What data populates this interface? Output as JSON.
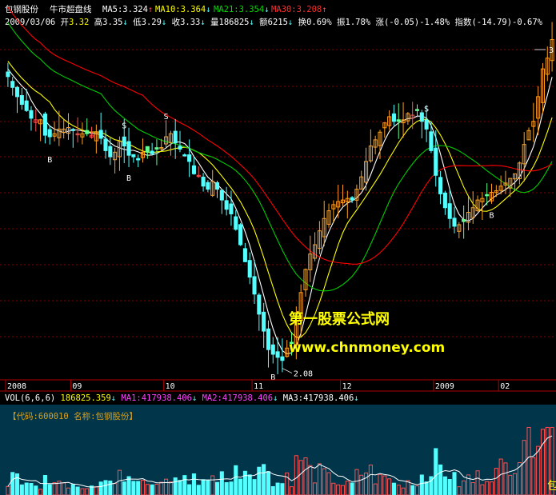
{
  "header": {
    "name": "包钢股份",
    "indicator": "牛市超盘线",
    "ma5_label": "MA5:",
    "ma5": "3.324",
    "ma10_label": "MA10:",
    "ma10": "3.364",
    "ma21_label": "MA21:",
    "ma21": "3.354",
    "ma30_label": "MA30:",
    "ma30": "3.208"
  },
  "quote": {
    "date": "2009/03/06",
    "open_label": "开",
    "open": "3.32",
    "high_label": "高",
    "high": "3.35",
    "low_label": "低",
    "low": "3.29",
    "close_label": "收",
    "close": "3.33",
    "volume_label": "量",
    "volume": "186825",
    "amount_label": "额",
    "amount": "6215",
    "turnover_label": "换",
    "turnover": "0.69%",
    "amplitude_label": "振",
    "amplitude": "1.78%",
    "change_label": "涨",
    "change": "(-0.05)-1.48%",
    "index_label": "指数",
    "index_change": "(-14.79)-0.67%"
  },
  "watermark": {
    "line1": "第一股票公式网",
    "line2": "www.chnmoney.com"
  },
  "volume_panel": {
    "title": "VOL(6,6,6)",
    "vol": "186825.359",
    "ma1_label": "MA1:",
    "ma1": "417938.406",
    "ma2_label": "MA2:",
    "ma2": "417938.406",
    "ma3_label": "MA3:",
    "ma3": "417938.406",
    "info": "【代码:600010 名称:包钢股份】",
    "corner_glyph": "包"
  },
  "colors": {
    "up": "#ff5050",
    "down": "#54ffff",
    "yellow_body": "#ffa020",
    "green_body": "#60ff90",
    "ma_white": "#ffffff",
    "ma_yellow": "#ffff00",
    "ma_green": "#00cc00",
    "ma_red": "#ff0000",
    "grid": "#8b0000",
    "volume_bg": "#00354a"
  },
  "chart_data": {
    "type": "candlestick",
    "x_tick_labels": [
      "2008",
      "09",
      "10",
      "11",
      "12",
      "2009",
      "02"
    ],
    "signal_labels": [
      "B",
      "S"
    ],
    "annotations": [
      "2.08",
      "3"
    ],
    "low_point": 2.08,
    "price_range": [
      2.0,
      4.25
    ],
    "close_series": [
      3.94,
      3.87,
      3.81,
      3.76,
      3.72,
      3.67,
      3.66,
      3.66,
      3.56,
      3.55,
      3.57,
      3.6,
      3.6,
      3.61,
      3.59,
      3.57,
      3.57,
      3.57,
      3.56,
      3.58,
      3.54,
      3.46,
      3.42,
      3.45,
      3.52,
      3.49,
      3.43,
      3.42,
      3.4,
      3.45,
      3.45,
      3.44,
      3.47,
      3.48,
      3.55,
      3.57,
      3.51,
      3.47,
      3.43,
      3.39,
      3.31,
      3.3,
      3.23,
      3.21,
      3.26,
      3.21,
      3.14,
      3.08,
      3.05,
      2.95,
      2.85,
      2.74,
      2.64,
      2.53,
      2.4,
      2.29,
      2.17,
      2.14,
      2.12,
      2.1,
      2.18,
      2.21,
      2.36,
      2.54,
      2.69,
      2.79,
      2.85,
      2.94,
      3.02,
      3.07,
      3.11,
      3.13,
      3.14,
      3.15,
      3.14,
      3.21,
      3.29,
      3.39,
      3.49,
      3.53,
      3.58,
      3.64,
      3.68,
      3.65,
      3.65,
      3.66,
      3.7,
      3.69,
      3.72,
      3.65,
      3.6,
      3.46,
      3.3,
      3.18,
      3.09,
      3.02,
      2.97,
      2.98,
      3.0,
      3.06,
      3.09,
      3.14,
      3.15,
      3.17,
      3.19,
      3.2,
      3.23,
      3.25,
      3.28,
      3.31,
      3.38,
      3.5,
      3.59,
      3.65,
      3.81,
      3.99,
      4.06,
      4.18
    ],
    "volume_range": [
      0,
      1200000
    ]
  }
}
